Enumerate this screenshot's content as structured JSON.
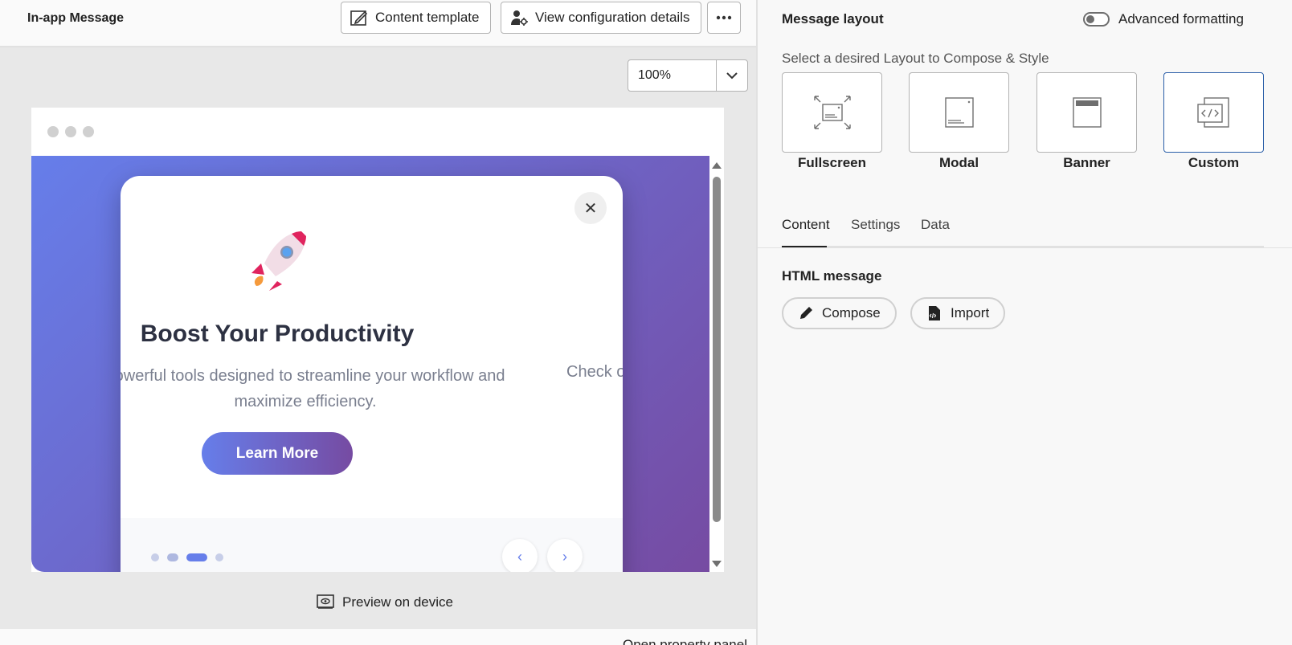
{
  "header": {
    "title": "In-app Message",
    "content_template_label": "Content template",
    "view_config_label": "View configuration details",
    "more_icon": "more-horizontal-icon"
  },
  "zoom": {
    "value": "100%"
  },
  "preview_message": {
    "headline": "Boost Your Productivity",
    "description": "powerful tools designed to streamline your workflow and maximize efficiency.",
    "next_slide_text": "Check o",
    "cta_label": "Learn More",
    "close_glyph": "✕",
    "prev_glyph": "‹",
    "next_glyph": "›",
    "active_slide": 3,
    "slide_count": 4,
    "gradient": [
      "#667eea",
      "#764ba2"
    ]
  },
  "preview_on_device_label": "Preview on device",
  "open_property_panel_label": "Open property panel",
  "right_panel": {
    "title": "Message layout",
    "advanced_formatting_label": "Advanced formatting",
    "advanced_formatting_on": false,
    "select_hint": "Select a desired Layout to Compose & Style",
    "layouts": [
      {
        "label": "Fullscreen",
        "icon": "fullscreen-layout-icon"
      },
      {
        "label": "Modal",
        "icon": "modal-layout-icon"
      },
      {
        "label": "Banner",
        "icon": "banner-layout-icon"
      },
      {
        "label": "Custom",
        "icon": "custom-code-layout-icon"
      }
    ],
    "selected_layout": "Custom",
    "tabs": [
      "Content",
      "Settings",
      "Data"
    ],
    "active_tab": "Content",
    "html_message_label": "HTML message",
    "compose_label": "Compose",
    "import_label": "Import"
  },
  "colors": {
    "accent": "#2a5ea8",
    "cta_start": "#667eea",
    "cta_end": "#764ba2"
  }
}
